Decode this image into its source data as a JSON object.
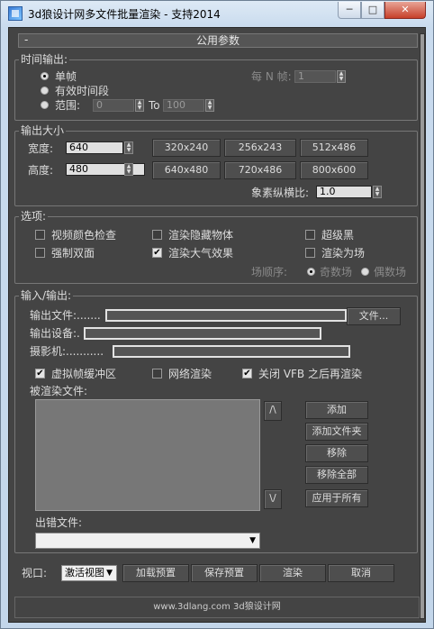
{
  "window": {
    "title": "3d狼设计网多文件批量渲染 - 支持2014",
    "min": "─",
    "max": "□",
    "close": "✕"
  },
  "rollout": {
    "title": "公用参数",
    "collapse": "-"
  },
  "time_output": {
    "group": "时间输出:",
    "single": "单帧",
    "active_segment": "有效时间段",
    "range": "范围:",
    "range_from": "0",
    "to": "To",
    "range_to": "100",
    "every_n_label": "每 N 帧:",
    "every_n_value": "1"
  },
  "output_size": {
    "group": "输出大小",
    "width_label": "宽度:",
    "width": "640",
    "height_label": "高度:",
    "height": "480",
    "presets": [
      "320x240",
      "256x243",
      "512x486",
      "640x480",
      "720x486",
      "800x600"
    ],
    "aspect_label": "象素纵横比:",
    "aspect_value": "1.0"
  },
  "options": {
    "group": "选项:",
    "video_color_check": "视频颜色检查",
    "render_hidden": "渲染隐藏物体",
    "super_black": "超级黑",
    "force_2sided": "强制双面",
    "render_atmos": "渲染大气效果",
    "render_fields": "渲染为场",
    "field_order": "场顺序:",
    "odd": "奇数场",
    "even": "偶数场"
  },
  "io": {
    "group": "输入/输出:",
    "output_file": "输出文件:.......",
    "file_button": "文件...",
    "output_device": "输出设备:.",
    "camera": "摄影机:...........",
    "vfb": "虚拟帧缓冲区",
    "net_render": "网络渲染",
    "close_vfb": "关闭 VFB 之后再渲染",
    "render_files": "被渲染文件:",
    "up": "/\\",
    "down": "\\/",
    "add": "添加",
    "add_folder": "添加文件夹",
    "remove": "移除",
    "remove_all": "移除全部",
    "apply_all": "应用于所有",
    "error_file": "出错文件:"
  },
  "bottom": {
    "viewport_label": "视口:",
    "viewport_value": "激活视图",
    "load_preset": "加载预置",
    "save_preset": "保存预置",
    "render": "渲染",
    "cancel": "取消"
  },
  "footer": {
    "text": "www.3dlang.com  3d狼设计网"
  }
}
